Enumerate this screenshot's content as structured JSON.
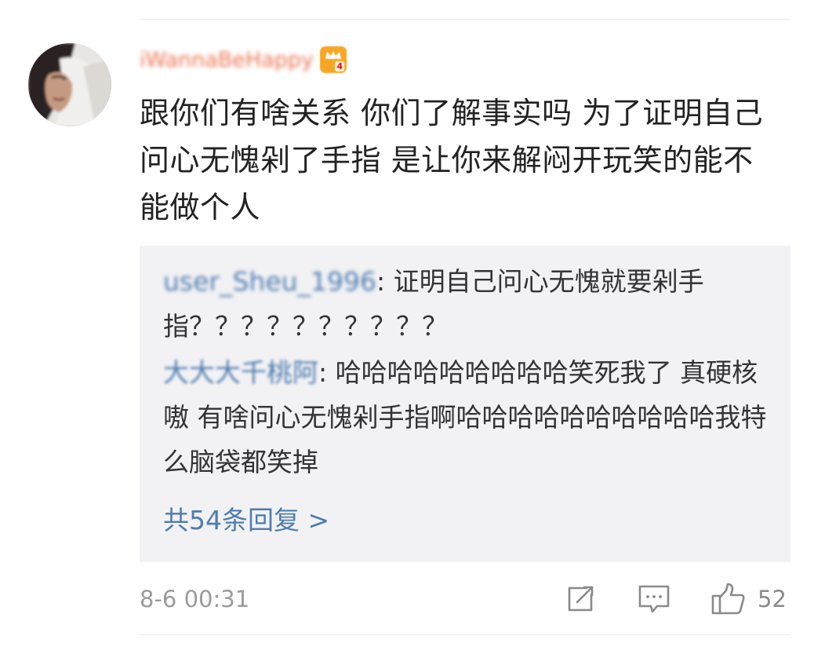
{
  "comment": {
    "username": "iWannaBeHappy",
    "badge_level": "4",
    "text": "跟你们有啥关系 你们了解事实吗 为了证明自己问心无愧剁了手指 是让你来解闷开玩笑的能不能做个人",
    "timestamp": "8-6 00:31",
    "like_count": "52"
  },
  "replies": [
    {
      "author": "user_Sheu_1996",
      "separator": ": ",
      "text": "证明自己问心无愧就要剁手指？？？？？？？？？？"
    },
    {
      "author": "大大大千桃阿",
      "separator": ": ",
      "text": "哈哈哈哈哈哈哈哈哈笑死我了 真硬核嗷 有啥问心无愧剁手指啊哈哈哈哈哈哈哈哈哈哈我特么脑袋都笑掉"
    }
  ],
  "more_replies_label": "共54条回复 >",
  "icons": {
    "repost": "repost-icon",
    "comment": "comment-icon",
    "like": "thumbs-up-icon"
  },
  "colors": {
    "username": "#eb7350",
    "link": "#4f7cae",
    "reply_bg": "#f2f2f5",
    "meta": "#9b9b9b",
    "badge": "#f6a623"
  }
}
